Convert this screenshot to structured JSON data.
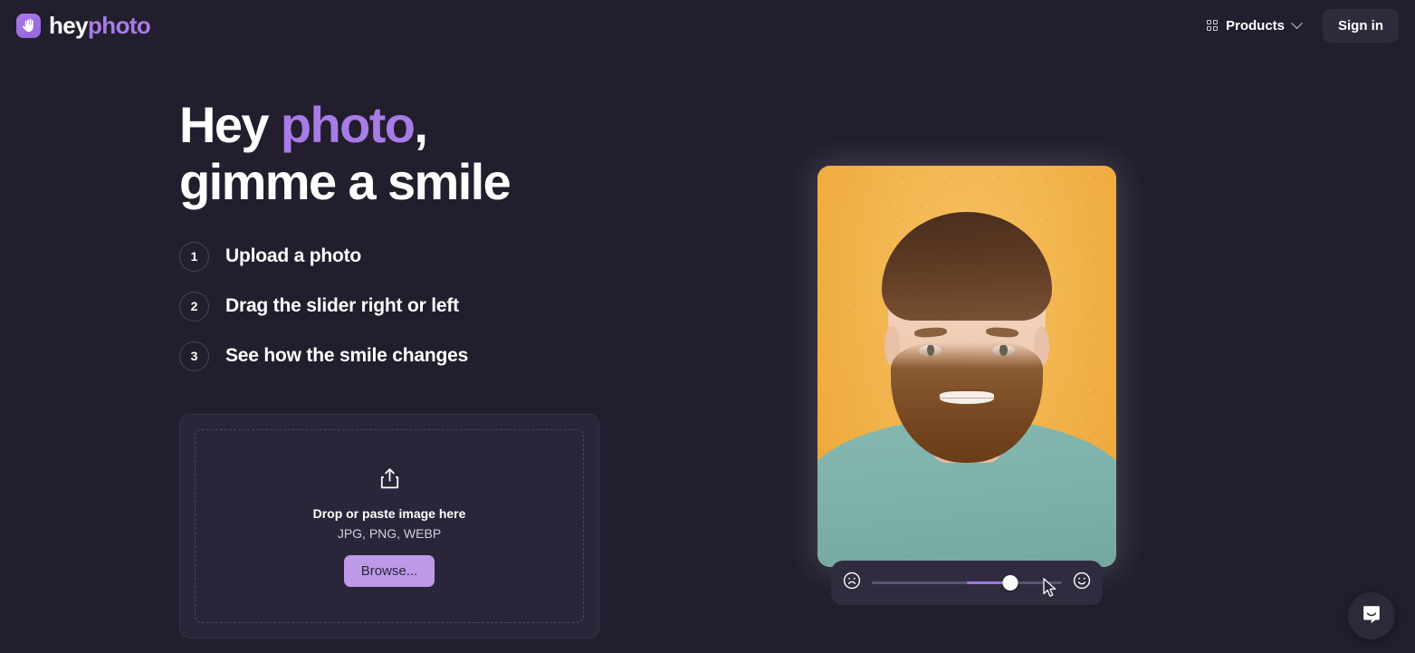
{
  "brand": {
    "icon": "waving-hand-icon",
    "name_first": "hey",
    "name_second": "photo"
  },
  "header": {
    "products_label": "Products",
    "products_icon": "grid-icon",
    "chevron_icon": "chevron-down-icon",
    "signin_label": "Sign in"
  },
  "hero": {
    "headline_part1": "Hey ",
    "headline_accent": "photo",
    "headline_part2": ",",
    "headline_line2": "gimme a smile",
    "steps": [
      {
        "num": "1",
        "label": "Upload a photo"
      },
      {
        "num": "2",
        "label": "Drag the slider right or left"
      },
      {
        "num": "3",
        "label": "See how the smile changes"
      }
    ]
  },
  "upload": {
    "icon": "upload-share-icon",
    "title": "Drop or paste image here",
    "formats": "JPG, PNG, WEBP",
    "browse_label": "Browse..."
  },
  "preview": {
    "slider": {
      "min_icon": "frowning-face-icon",
      "max_icon": "smiling-face-icon",
      "value_percent": 73
    }
  },
  "widget": {
    "chat_icon": "intercom-chat-icon"
  },
  "colors": {
    "page_bg": "#221e2d",
    "accent_purple": "#a77ce6",
    "browse_bg": "#bd9ae8",
    "card_bg": "#2a2538",
    "slider_fill": "#9d79e0",
    "photo_bg": "#f3b750",
    "shirt": "#7cb0a8"
  }
}
